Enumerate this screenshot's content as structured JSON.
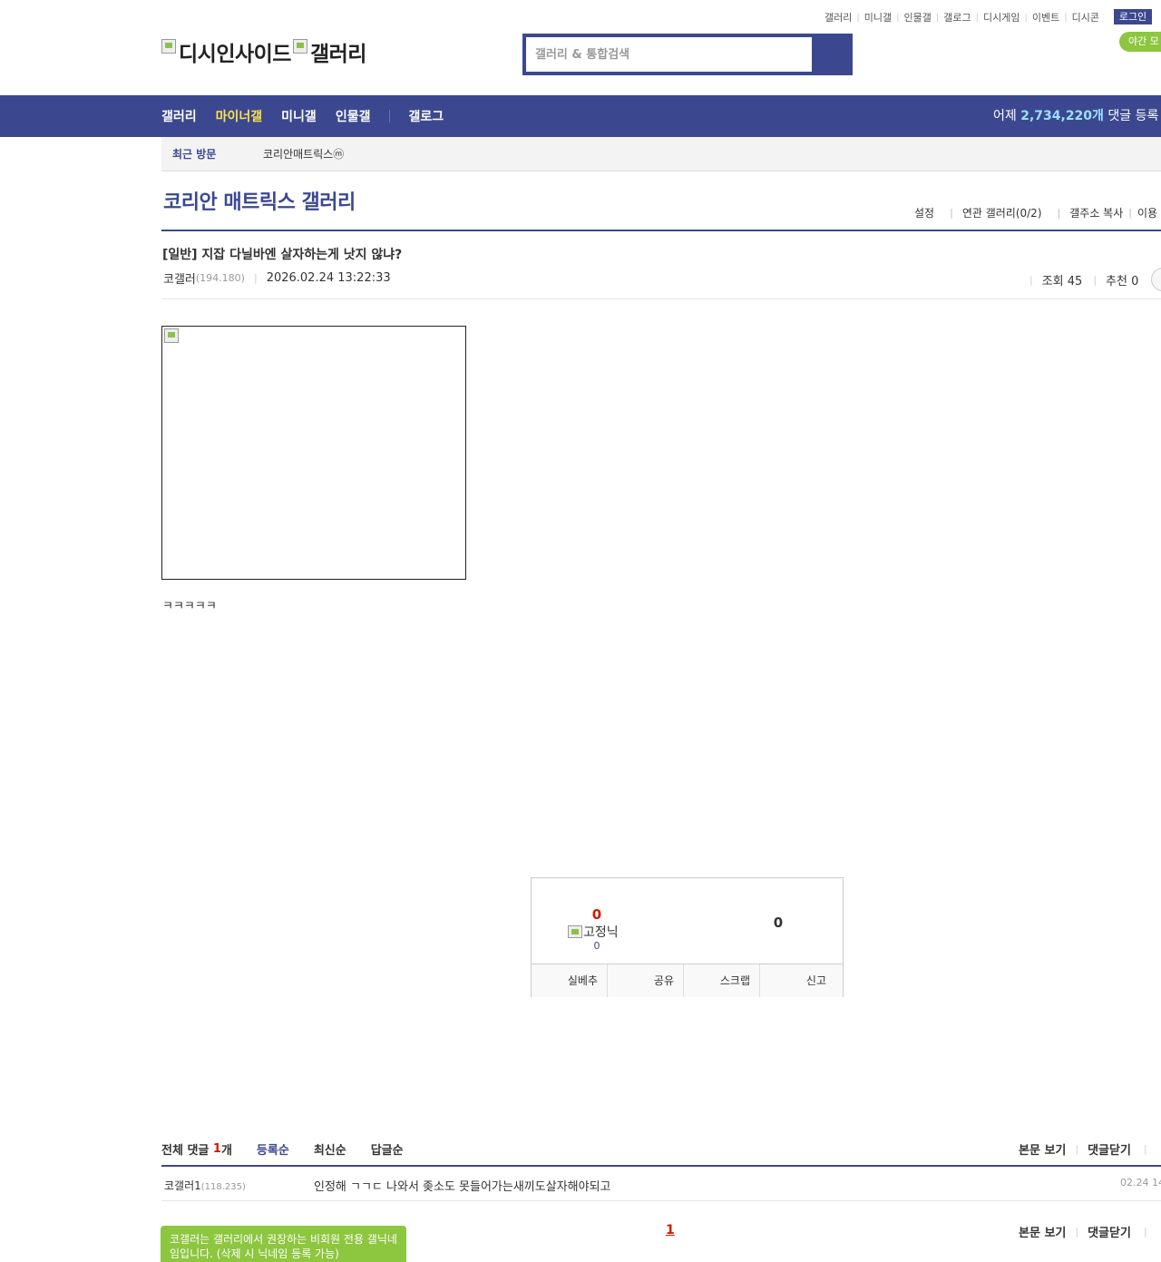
{
  "top_links": [
    "갤러리",
    "미니갤",
    "인물갤",
    "갤로그",
    "디시게임",
    "이벤트",
    "디시콘"
  ],
  "login_label": "로그인",
  "night_mode_label": "야간 모",
  "logo": {
    "part1": "디시인사이드",
    "part2": "갤러리"
  },
  "search": {
    "placeholder": "갤러리 & 통합검색"
  },
  "nav": {
    "items": [
      "갤러리",
      "마이너갤",
      "미니갤",
      "인물갤",
      "갤로그"
    ],
    "active_index": 1,
    "yesterday_prefix": "어제",
    "yesterday_count": "2,734,220개",
    "yesterday_suffix": "댓글 등록"
  },
  "recent": {
    "title": "최근 방문",
    "item": "코리안매트릭스ⓜ"
  },
  "gallery": {
    "title": "코리안 매트릭스 갤러리",
    "menu": [
      "설정",
      "연관 갤러리(0/2)",
      "갤주소 복사",
      "이용"
    ]
  },
  "post": {
    "title": "[일반] 지잡 다닐바엔 살자하는게 낫지 않냐?",
    "author": "코갤러",
    "ip": "(194.180)",
    "date": "2026.02.24 13:22:33",
    "views_label": "조회 45",
    "recommend_label": "추천 0",
    "body_text": "ㅋㅋㅋㅋㅋ"
  },
  "vote": {
    "up_count": "0",
    "fixed_nick_label": "고정닉",
    "fixed_nick_count": "0",
    "down_count": "0",
    "buttons": [
      "실베추",
      "공유",
      "스크랩",
      "신고"
    ]
  },
  "comments": {
    "label": "전체 댓글",
    "count": "1",
    "unit": "개",
    "sorts": [
      "등록순",
      "최신순",
      "답글순"
    ],
    "right_links": [
      "본문 보기",
      "댓글닫기"
    ],
    "items": [
      {
        "nick": "코갤러1",
        "ip": "(118.235)",
        "text": "인정해 ㄱㄱㄷ 나와서 좆소도 못들어가는새끼도살자해야되고",
        "date": "02.24 14"
      }
    ]
  },
  "footer": {
    "tip": "코갤러는 갤러리에서 권장하는 비회원 전용 갤닉네임입니다. (삭제 시 닉네임 등록 가능)",
    "page": "1",
    "right_links": [
      "본문 보기",
      "댓글닫기"
    ]
  },
  "colors": {
    "brand": "#3b4890",
    "accent_green": "#8dc63f",
    "highlight": "#ffe14a",
    "red": "#d31900"
  }
}
